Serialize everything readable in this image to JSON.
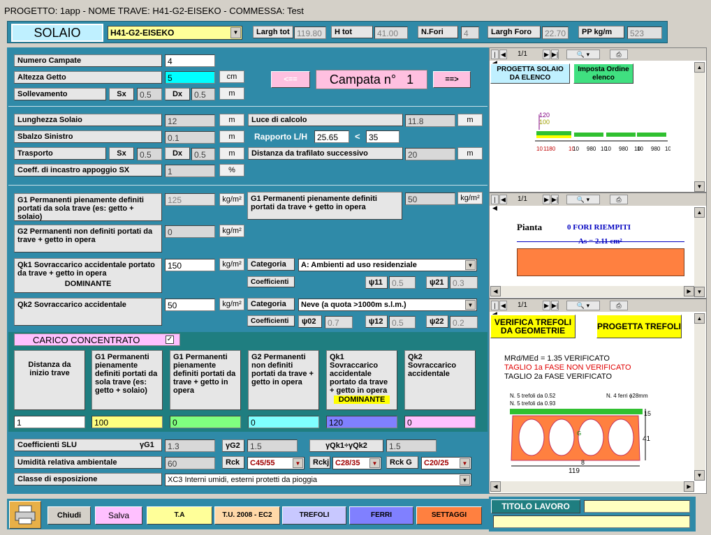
{
  "title": "PROGETTO: 1app - NOME TRAVE: H41-G2-EISEKO - COMMESSA: Test",
  "header": {
    "solaio": "SOLAIO",
    "trave": "H41-G2-EISEKO",
    "largh_tot_l": "Largh tot",
    "largh_tot": "119.80",
    "h_tot_l": "H tot",
    "h_tot": "41.00",
    "nfori_l": "N.Fori",
    "nfori": "4",
    "largh_foro_l": "Largh Foro",
    "largh_foro": "22.70",
    "pp_l": "PP kg/m",
    "pp": "523"
  },
  "campata": {
    "numero_l": "Numero Campate",
    "numero": "4",
    "altezza_l": "Altezza Getto",
    "altezza": "5",
    "cm": "cm",
    "soll_l": "Sollevamento",
    "sx": "Sx",
    "sx_v": "0.5",
    "dx": "Dx",
    "dx_v": "0.5",
    "m": "m",
    "prev": "<==",
    "next": "==>",
    "campata_l": "Campata n°",
    "campata_n": "1"
  },
  "geom": {
    "lung_l": "Lunghezza Solaio",
    "lung": "12",
    "luce_l": "Luce di calcolo",
    "luce": "11.8",
    "sbalzo_l": "Sbalzo Sinistro",
    "sbalzo": "0.1",
    "rapp_l": "Rapporto L/H",
    "rapp": "25.65",
    "lt": "<",
    "rapp_max": "35",
    "trasp_l": "Trasporto",
    "sx": "Sx",
    "sx_v": "0.5",
    "dx": "Dx",
    "dx_v": "0.5",
    "dist_l": "Distanza da trafilato successivo",
    "dist": "20",
    "coeff_l": "Coeff. di incastro appoggio SX",
    "coeff": "1",
    "pct": "%",
    "m": "m"
  },
  "loads": {
    "g1a_l": "G1 Permanenti pienamente definiti portati da sola trave (es: getto + solaio)",
    "g1a": "125",
    "kg": "kg/m²",
    "g1b_l": "G1 Permanenti pienamente definiti portati da trave + getto in opera",
    "g1b": "50",
    "g2_l": "G2 Permanenti non definiti portati da trave + getto in opera",
    "g2": "0",
    "qk1_l": "Qk1 Sovraccarico accidentale portato da trave + getto in opera",
    "dominante": "DOMINANTE",
    "qk1": "150",
    "cat_l": "Categoria",
    "cat1": "A: Ambienti ad uso residenziale",
    "coef_l": "Coefficienti",
    "psi11": "ψ11",
    "psi11_v": "0.5",
    "psi21": "ψ21",
    "psi21_v": "0.3",
    "qk2_l": "Qk2  Sovraccarico accidentale",
    "qk2": "50",
    "cat2": "Neve (a quota >1000m s.l.m.)",
    "psi02": "ψ02",
    "psi02_v": "0.7",
    "psi12": "ψ12",
    "psi12_v": "0.5",
    "psi22": "ψ22",
    "psi22_v": "0.2"
  },
  "conc": {
    "title": "CARICO CONCENTRATO",
    "check": "✓",
    "c1": "Distanza da inizio trave",
    "c2": "G1 Permanenti pienamente definiti portati da sola trave (es: getto + solaio)",
    "c3": "G1 Permanenti pienamente definiti portati da trave + getto in opera",
    "c4": "G2 Permanenti non definiti portati da trave + getto in opera",
    "c5": "Qk1 Sovraccarico accidentale portato da trave + getto in opera",
    "c5b": "DOMINANTE",
    "c6": "Qk2 Sovraccarico accidentale",
    "v1": "1",
    "v2": "100",
    "v3": "0",
    "v4": "0",
    "v5": "120",
    "v6": "0"
  },
  "slu": {
    "coef_l": "Coefficienti SLU",
    "g1": "γG1",
    "g1_v": "1.3",
    "g2": "γG2",
    "g2_v": "1.5",
    "q": "γQk1÷γQk2",
    "q_v": "1.5",
    "umid_l": "Umidità relativa ambientale",
    "umid": "60",
    "rck": "Rck",
    "rck_v": "C45/55",
    "rckj": "Rckj",
    "rckj_v": "C28/35",
    "rckg": "Rck G",
    "rckg_v": "C20/25",
    "classe_l": "Classe di esposizione",
    "classe": "XC3   Interni umidi, esterni protetti da pioggia"
  },
  "bottom": {
    "chiudi": "Chiudi",
    "salva": "Salva",
    "ta": "T.A",
    "tu": "T.U. 2008 - EC2",
    "trefoli": "TREFOLI",
    "ferri": "FERRI",
    "settaggi": "SETTAGGI",
    "titolo": "TITOLO LAVORO"
  },
  "viewer": {
    "page": "1/1",
    "btn1": "PROGETTA SOLAIO DA ELENCO",
    "btn2": "Imposta Ordine elenco",
    "pianta": "Pianta",
    "fori": "0 FORI RIEMPITI",
    "as": "As = 2.11 cm²",
    "verifica": "VERIFICA TREFOLI DA GEOMETRIE",
    "progetta": "PROGETTA TREFOLI",
    "r1": "MRd/MEd = 1.35 VERIFICATO",
    "r2": "TAGLIO 1a FASE NON VERIFICATO",
    "r3": "TAGLIO 2a FASE VERIFICATO",
    "t1": "N. 5 trefoli da 0.52",
    "t2": "N. 5 trefoli da 0.93",
    "t3": "N. 4 ferri ϕ28mm",
    "d15": "15",
    "d41": "41",
    "d119": "119",
    "d8": "8",
    "g": "G",
    "beam_120": "120",
    "beam_100": "100",
    "spans": [
      "10",
      "1180",
      "10",
      "10",
      "980",
      "10",
      "10",
      "980",
      "10",
      "10",
      "980",
      "10"
    ]
  },
  "colors": {
    "panel": "#2f8aa8",
    "yellow": "#ffff80",
    "cyan": "#00ffff",
    "pink": "#ffc0ff"
  }
}
